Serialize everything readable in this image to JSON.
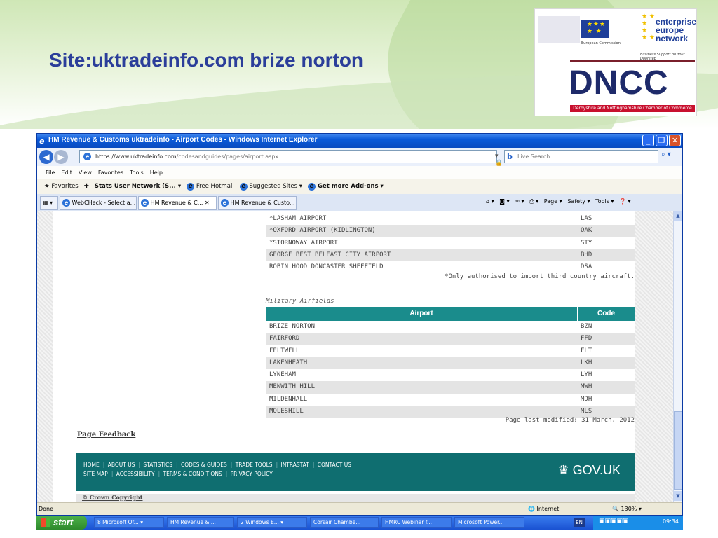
{
  "slide": {
    "title": "Site:uktradeinfo.com brize norton",
    "logos": {
      "eu_text": "European Commission",
      "een_lines": [
        "enterprise",
        "europe",
        "network"
      ],
      "een_tagline": "Business Support on Your Doorstep",
      "dncc": "DNCC",
      "dncc_sub": "Derbyshire and Nottinghamshire Chamber of Commerce"
    }
  },
  "browser": {
    "title": "HM Revenue & Customs uktradeinfo - Airport Codes - Windows Internet Explorer",
    "address": {
      "prefix": "https://www.uktradeinfo.com",
      "rest": "/codesandguides/pages/airport.aspx"
    },
    "search_placeholder": "Live Search",
    "menu": [
      "File",
      "Edit",
      "View",
      "Favorites",
      "Tools",
      "Help"
    ],
    "favorites": {
      "label": "Favorites",
      "items": [
        "Stats User Network (S... ▾",
        "Free Hotmail",
        "Suggested Sites ▾",
        "Get more Add-ons ▾"
      ]
    },
    "tabs": [
      "WebCHeck - Select a...",
      "HM Revenue & C...",
      "HM Revenue & Custo..."
    ],
    "command_bar": [
      "Page ▾",
      "Safety ▾",
      "Tools ▾"
    ],
    "status": {
      "left": "Done",
      "zone": "Internet",
      "zoom": "130%"
    }
  },
  "page": {
    "civil_rows": [
      {
        "airport": "*LASHAM AIRPORT",
        "code": "LAS"
      },
      {
        "airport": "*OXFORD AIRPORT (KIDLINGTON)",
        "code": "OAK"
      },
      {
        "airport": "*STORNOWAY AIRPORT",
        "code": "STY"
      },
      {
        "airport": "GEORGE BEST BELFAST CITY AIRPORT",
        "code": "BHD"
      },
      {
        "airport": "ROBIN HOOD DONCASTER SHEFFIELD",
        "code": "DSA"
      }
    ],
    "civil_note": "*Only authorised to import third country aircraft.",
    "military_caption": "Military Airfields",
    "headers": {
      "airport": "Airport",
      "code": "Code"
    },
    "military_rows": [
      {
        "airport": "BRIZE NORTON",
        "code": "BZN"
      },
      {
        "airport": "FAIRFORD",
        "code": "FFD"
      },
      {
        "airport": "FELTWELL",
        "code": "FLT"
      },
      {
        "airport": "LAKENHEATH",
        "code": "LKH"
      },
      {
        "airport": "LYNEHAM",
        "code": "LYH"
      },
      {
        "airport": "MENWITH HILL",
        "code": "MWH"
      },
      {
        "airport": "MILDENHALL",
        "code": "MDH"
      },
      {
        "airport": "MOLESHILL",
        "code": "MLS"
      }
    ],
    "last_modified": "Page last modified: 31 March, 2012",
    "feedback": "Page Feedback",
    "footer_links_1": [
      "HOME",
      "ABOUT US",
      "STATISTICS",
      "CODES & GUIDES",
      "TRADE TOOLS",
      "INTRASTAT",
      "CONTACT US"
    ],
    "footer_links_2": [
      "SITE MAP",
      "ACCESSIBILITY",
      "TERMS & CONDITIONS",
      "PRIVACY POLICY"
    ],
    "govuk": "GOV.UK",
    "copyright": "© Crown Copyright"
  },
  "taskbar": {
    "start": "start",
    "items": [
      "8 Microsoft Of... ▾",
      "HM Revenue & ...",
      "2 Windows E... ▾",
      "Corsair Chambe...",
      "HMRC Webinar f...",
      "Microsoft Power..."
    ],
    "lang": "EN",
    "clock": "09:34"
  }
}
